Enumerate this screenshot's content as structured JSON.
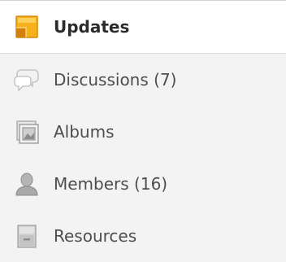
{
  "nav": {
    "items": [
      {
        "label": "Updates",
        "icon": "updates-icon",
        "active": true
      },
      {
        "label": "Discussions (7)",
        "icon": "chat-bubbles-icon",
        "active": false
      },
      {
        "label": "Albums",
        "icon": "photo-album-icon",
        "active": false
      },
      {
        "label": "Members (16)",
        "icon": "member-person-icon",
        "active": false
      },
      {
        "label": "Resources",
        "icon": "file-cabinet-icon",
        "active": false
      }
    ]
  },
  "colors": {
    "updates_icon": "#f7b21b",
    "inactive_bg": "#f3f3f3",
    "active_bg": "#ffffff"
  }
}
